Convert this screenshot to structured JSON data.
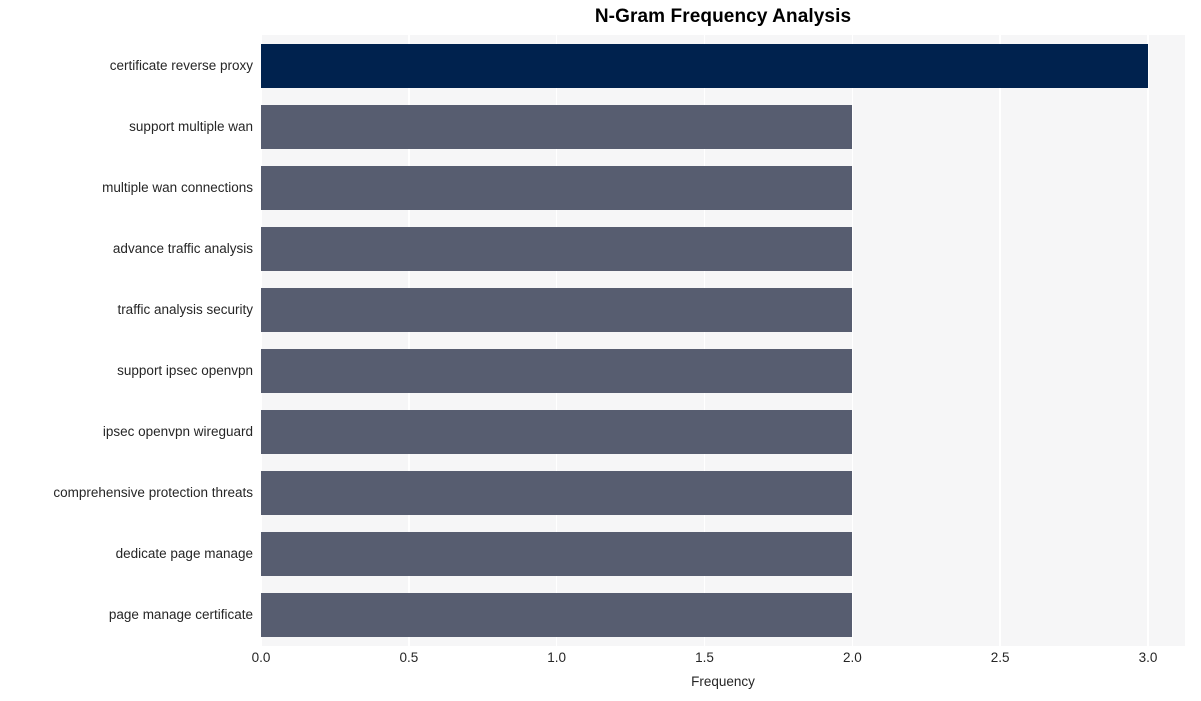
{
  "chart_data": {
    "type": "bar",
    "orientation": "horizontal",
    "title": "N-Gram Frequency Analysis",
    "xlabel": "Frequency",
    "ylabel": "",
    "xlim": [
      0.0,
      3.125
    ],
    "xticks": [
      "0.0",
      "0.5",
      "1.0",
      "1.5",
      "2.0",
      "2.5",
      "3.0"
    ],
    "xtick_values": [
      0.0,
      0.5,
      1.0,
      1.5,
      2.0,
      2.5,
      3.0
    ],
    "grid": "vertical-white",
    "legend": "none",
    "categories": [
      "certificate reverse proxy",
      "support multiple wan",
      "multiple wan connections",
      "advance traffic analysis",
      "traffic analysis security",
      "support ipsec openvpn",
      "ipsec openvpn wireguard",
      "comprehensive protection threats",
      "dedicate page manage",
      "page manage certificate"
    ],
    "values": [
      3,
      2,
      2,
      2,
      2,
      2,
      2,
      2,
      2,
      2
    ],
    "bar_colors": [
      "#00224e",
      "#575d70",
      "#575d70",
      "#575d70",
      "#575d70",
      "#575d70",
      "#575d70",
      "#575d70",
      "#575d70",
      "#575d70"
    ],
    "plot_background": "#f6f6f7",
    "figure_background": "#ffffff",
    "text_color": "#262626"
  }
}
